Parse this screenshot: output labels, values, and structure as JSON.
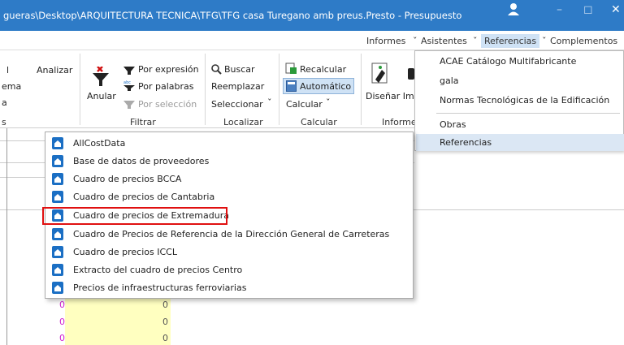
{
  "titlebar": {
    "title": "gueras\\Desktop\\ARQUITECTURA TECNICA\\TFG\\TFG casa Turegano amb preus.Presto - Presupuesto"
  },
  "menubar": {
    "items": [
      "Informes",
      "Asistentes",
      "Referencias",
      "Complementos"
    ],
    "active": "Referencias"
  },
  "ribbon": {
    "left_partial": [
      "l",
      "ema",
      "a",
      "s"
    ],
    "analizar": "Analizar",
    "anular": "Anular",
    "filtrar": {
      "por_expresion": "Por expresión",
      "por_palabras": "Por palabras",
      "por_seleccion": "Por selección",
      "label": "Filtrar"
    },
    "localizar": {
      "buscar": "Buscar",
      "reemplazar": "Reemplazar",
      "seleccionar": "Seleccionar",
      "label": "Localizar"
    },
    "calcular": {
      "recalcular": "Recalcular",
      "automatico": "Automático",
      "calcular": "Calcular",
      "label": "Calcular"
    },
    "informes": {
      "disenar": "Diseñar Imp",
      "label": "Informe"
    }
  },
  "referencias_menu": {
    "items": [
      "ACAE Catálogo Multifabricante",
      "gala",
      "Normas Tecnológicas de la Edificación",
      "Obras",
      "Referencias"
    ]
  },
  "submenu": {
    "items": [
      "AllCostData",
      "Base de datos de proveedores",
      "Cuadro de precios BCCA",
      "Cuadro de precios de Cantabria",
      "Cuadro de precios de Extremadura",
      "Cuadro de Precios de Referencia de la Dirección General de Carreteras",
      "Cuadro de precios ICCL",
      "Extracto del cuadro de precios Centro",
      "Precios de infraestructuras ferroviarias"
    ],
    "highlighted": "Cuadro de precios de Extremadura"
  },
  "sheet": {
    "zeros_left": [
      "0",
      "0",
      "0"
    ],
    "zeros_right": [
      "0",
      "0",
      "0"
    ]
  },
  "colors": {
    "titlebar": "#2e7bc7",
    "highlight_box": "#e01010",
    "cell_yellow": "#ffffc0",
    "zero_magenta": "#d020d0"
  }
}
